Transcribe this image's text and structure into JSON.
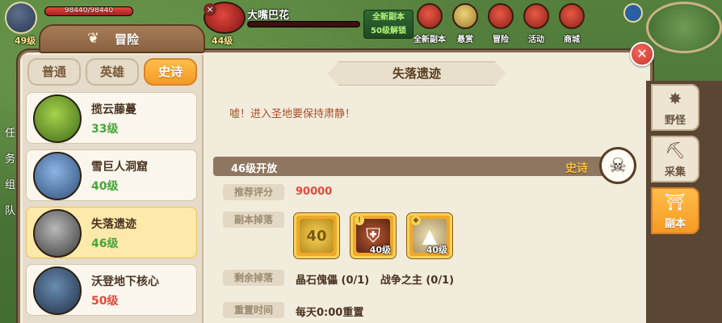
{
  "hud": {
    "player_hp": "98440/98440",
    "player_hp_fraction": 1.0,
    "player_level": "49级",
    "target_name": "大嘴巴花",
    "target_level": "44级",
    "new_dungeon_line1": "全新副本",
    "new_dungeon_line2": "50级解锁",
    "menu": [
      {
        "icon": "new-dungeon-icon",
        "label": "全新副本"
      },
      {
        "icon": "bounty-icon",
        "label": "悬赏"
      },
      {
        "icon": "adventure-icon",
        "label": "冒险"
      },
      {
        "icon": "event-icon",
        "label": "活动"
      },
      {
        "icon": "shop-icon",
        "label": "商城"
      }
    ]
  },
  "panel": {
    "title": "冒险",
    "close_symbol": "✕"
  },
  "tiers": [
    {
      "label": "普通",
      "active": false
    },
    {
      "label": "英雄",
      "active": false
    },
    {
      "label": "史诗",
      "active": true
    }
  ],
  "dungeons": [
    {
      "name": "揽云藤蔓",
      "level": "33级",
      "level_color": "green",
      "selected": false,
      "portrait_color": "#6a9a2e"
    },
    {
      "name": "雪巨人洞窟",
      "level": "40级",
      "level_color": "green",
      "selected": false,
      "portrait_color": "#4f78a8"
    },
    {
      "name": "失落遗迹",
      "level": "46级",
      "level_color": "green",
      "selected": true,
      "portrait_color": "#6a6a6a"
    },
    {
      "name": "沃登地下核心",
      "level": "50级",
      "level_color": "red",
      "selected": false,
      "portrait_color": "#3a5a78"
    }
  ],
  "detail": {
    "title": "失落遗迹",
    "description": "嘘！进入圣地要保持肃静！",
    "open_text": "46级开放",
    "tier_text": "史诗",
    "skull_symbol": "☠",
    "rec_label": "推荐评分",
    "rec_value": "90000",
    "drops_label": "副本掉落",
    "drops": [
      {
        "icon": "gold-coin-icon",
        "symbol": "40",
        "level": "",
        "mark": "",
        "bg": "#e4b43a"
      },
      {
        "icon": "helmet-armor-icon",
        "symbol": "⛨",
        "level": "40级",
        "mark": "!",
        "bg": "#8a3a22"
      },
      {
        "icon": "golem-pet-icon",
        "symbol": "▲",
        "level": "40级",
        "mark": "◆",
        "bg": "#c9b37a"
      }
    ],
    "remaining_label": "剩余掉落",
    "remaining_value": "晶石傀儡 (0/1)   战争之主 (0/1)",
    "reset_label": "重置时间",
    "reset_value": "每天0:00重置"
  },
  "side_tabs": [
    {
      "label": "野怪",
      "icon": "wild-monster-icon",
      "symbol": "✸",
      "active": false
    },
    {
      "label": "采集",
      "icon": "gather-pickaxe-icon",
      "symbol": "⛏",
      "active": false
    },
    {
      "label": "副本",
      "icon": "dungeon-gate-icon",
      "symbol": "⛩",
      "active": true
    }
  ],
  "side_fragment": [
    "任",
    "务",
    "组",
    "队"
  ]
}
